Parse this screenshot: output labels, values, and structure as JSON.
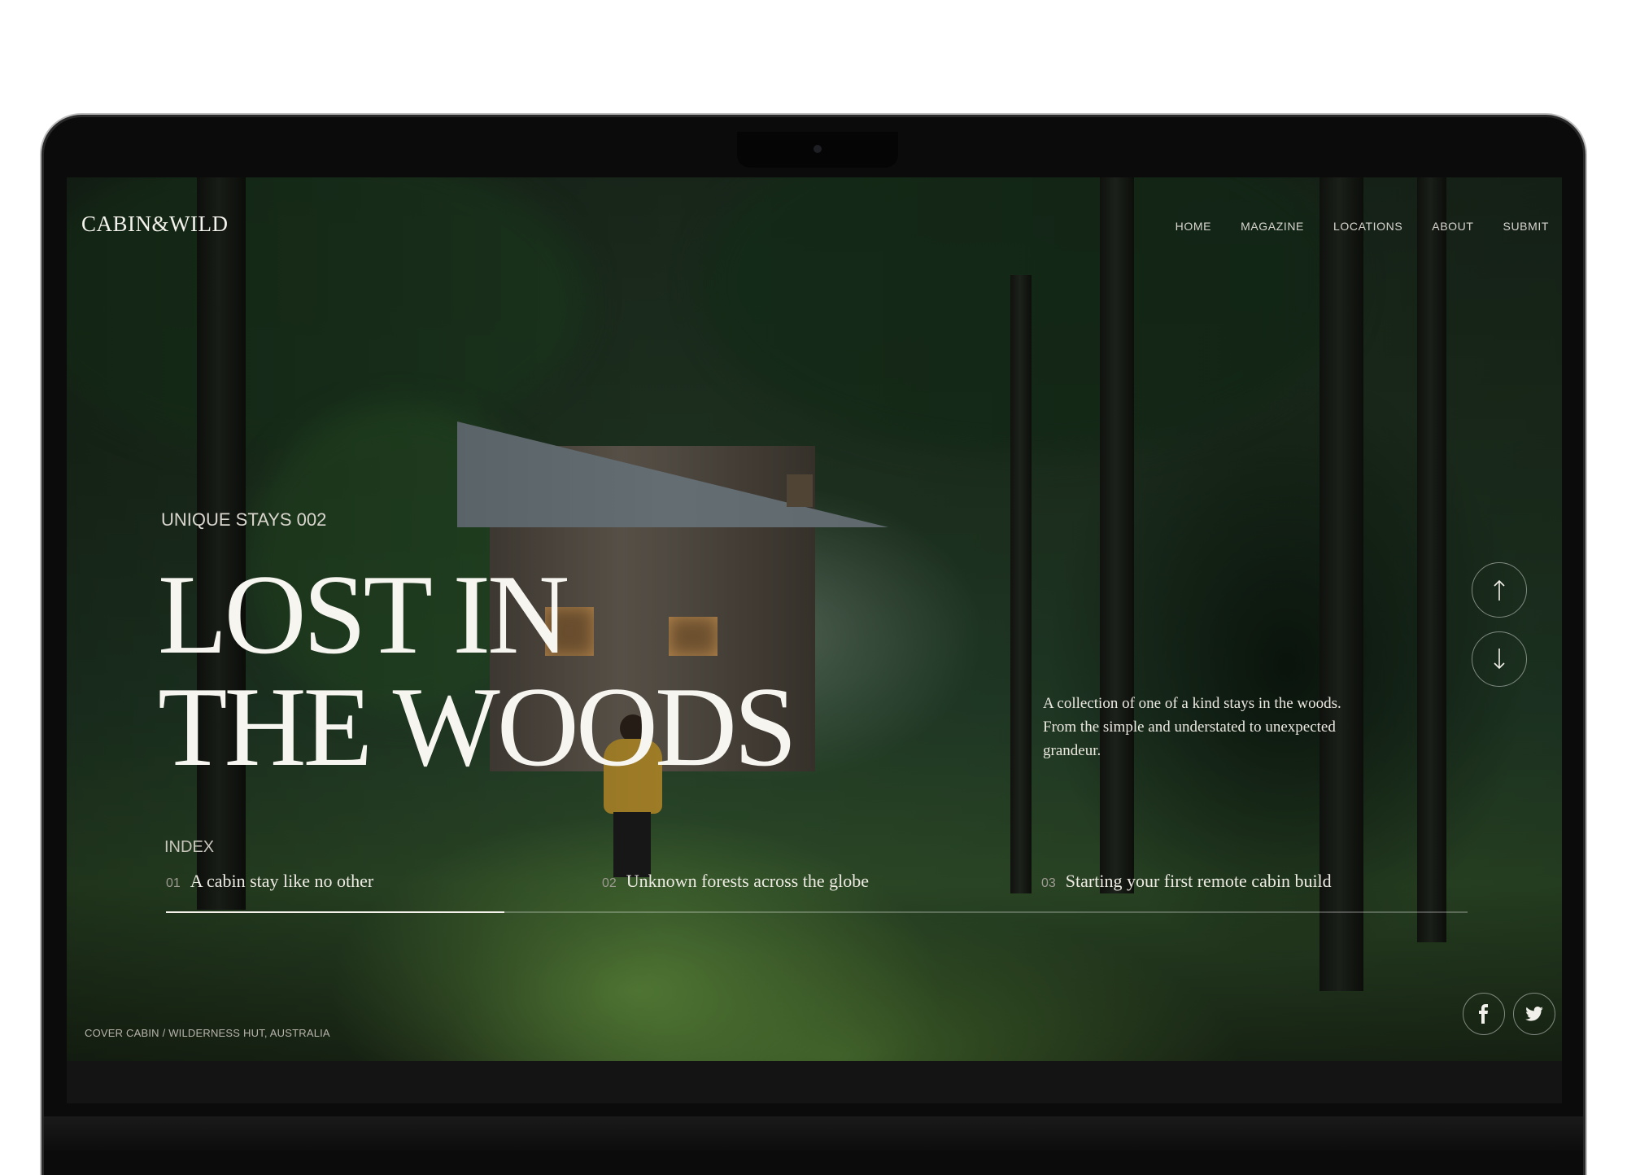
{
  "site": {
    "logo": "CABIN&WILD"
  },
  "nav": {
    "items": [
      "HOME",
      "MAGAZINE",
      "LOCATIONS",
      "ABOUT",
      "SUBMIT"
    ]
  },
  "hero": {
    "eyebrow": "UNIQUE STAYS 002",
    "headline_line1": "LOST IN",
    "headline_line2": "THE WOODS",
    "description": "A collection of one of a kind stays in the woods. From the simple and understated to unexpected grandeur."
  },
  "scroll_controls": {
    "up_icon": "arrow-up-icon",
    "down_icon": "arrow-down-icon"
  },
  "index": {
    "label": "INDEX",
    "active_progress": 0.26,
    "items": [
      {
        "num": "01",
        "title": "A cabin stay like no other"
      },
      {
        "num": "02",
        "title": "Unknown forests across the globe"
      },
      {
        "num": "03",
        "title": "Starting your first remote cabin build"
      }
    ]
  },
  "footer": {
    "caption": "COVER CABIN / WILDERNESS HUT, AUSTRALIA"
  },
  "social": {
    "icons": [
      "facebook-icon",
      "twitter-icon"
    ]
  },
  "colors": {
    "text_primary": "#f7f5f0",
    "forest_dark": "#1b2a1d",
    "moss_green": "#5f8c3c",
    "jacket_yellow": "#b08a2b"
  }
}
